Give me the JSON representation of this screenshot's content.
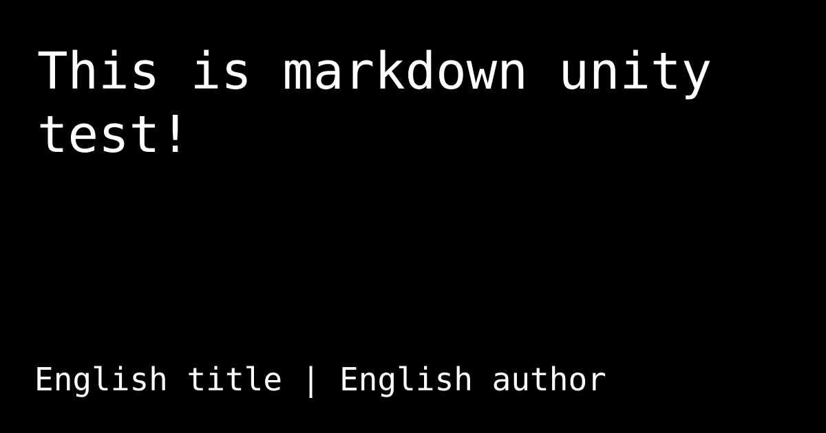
{
  "card": {
    "title": "This is markdown unity test!",
    "footer": "English title | English author"
  },
  "colors": {
    "background": "#000000",
    "text": "#ffffff"
  }
}
